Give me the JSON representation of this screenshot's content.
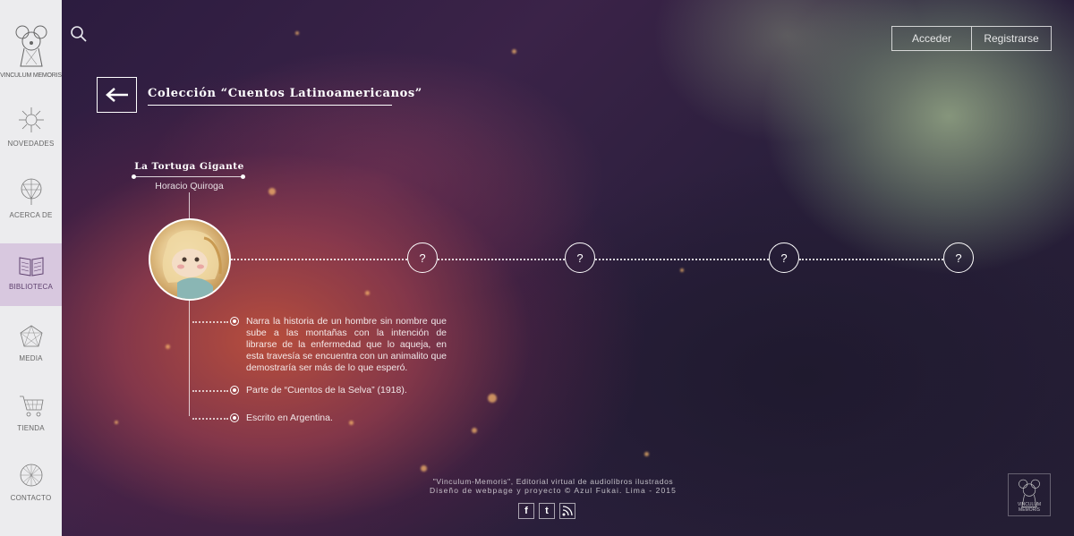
{
  "brand": {
    "name": "VINCULUM MEMORIS"
  },
  "sidebar": {
    "items": [
      {
        "label": "NOVEDADES",
        "icon": "sunburst-icon"
      },
      {
        "label": "ACERCA DE",
        "icon": "network-icon"
      },
      {
        "label": "BIBLIOTECA",
        "icon": "book-icon",
        "active": true
      },
      {
        "label": "MEDIA",
        "icon": "polygon-icon"
      },
      {
        "label": "TIENDA",
        "icon": "cart-icon"
      },
      {
        "label": "CONTACTO",
        "icon": "globe-icon"
      }
    ]
  },
  "header": {
    "search_icon": "search-icon",
    "login": "Acceder",
    "register": "Registrarse"
  },
  "collection": {
    "back_icon": "arrow-left-icon",
    "title": "Colección “Cuentos Latinoamericanos”"
  },
  "book": {
    "title": "La Tortuga Gigante",
    "author": "Horacio Quiroga",
    "details": [
      "Narra la historia de un hombre sin nombre que sube a las montañas con la intención de librarse de la enfermedad que lo aqueja, en esta travesía se encuentra con un animalito que demostraría ser más de lo que esperó.",
      "Parte de “Cuentos de la Selva” (1918).",
      "Escrito en Argentina."
    ]
  },
  "timeline": {
    "unknown_nodes": [
      "?",
      "?",
      "?",
      "?"
    ]
  },
  "footer": {
    "line1": "\"Vinculum-Memoris\", Editorial virtual de audiolibros ilustrados",
    "line2": "Diseño de webpage y proyecto © Azul Fukai. Lima - 2015",
    "social": [
      "facebook-icon",
      "twitter-icon",
      "rss-icon"
    ],
    "mini_logo_text": "VINCULUM MEMORIS"
  },
  "colors": {
    "sidebar_bg": "#ececee",
    "active_bg": "#d8c8df",
    "accent": "#5d3f6d"
  }
}
